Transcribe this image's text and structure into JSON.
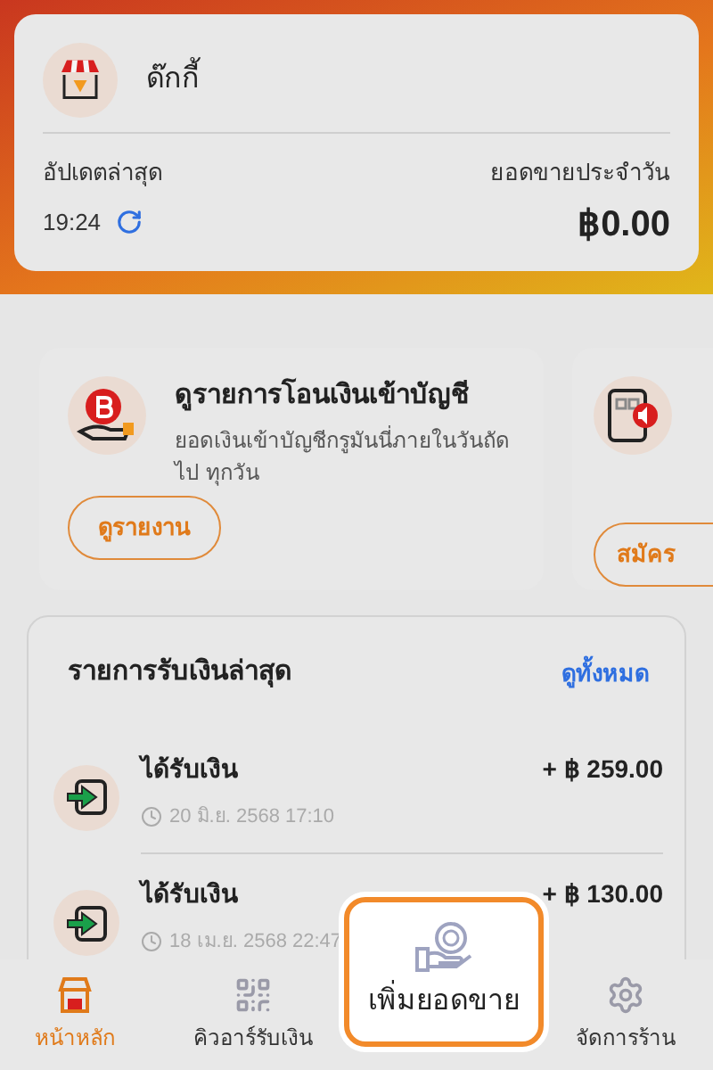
{
  "shop": {
    "name": "ด๊กกี้",
    "updated_label": "อัปเดตล่าสุด",
    "updated_time": "19:24",
    "sales_label": "ยอดขายประจำวัน",
    "sales_value": "฿0.00"
  },
  "promos": [
    {
      "title": "ดูรายการโอนเงินเข้าบัญชี",
      "description": "ยอดเงินเข้าบัญชีกรูมันนี่ภายในวันถัดไป ทุกวัน",
      "button": "ดูรายงาน"
    },
    {
      "button": "สมัคร"
    }
  ],
  "recent": {
    "title": "รายการรับเงินล่าสุด",
    "view_all": "ดูทั้งหมด",
    "items": [
      {
        "title": "ได้รับเงิน",
        "amount": "+ ฿ 259.00",
        "datetime": "20 มิ.ย. 2568 17:10"
      },
      {
        "title": "ได้รับเงิน",
        "amount": "+ ฿ 130.00",
        "datetime": "18 เม.ย. 2568 22:47"
      }
    ]
  },
  "nav": [
    {
      "kind": "home",
      "label": "หน้าหลัก",
      "selected": true
    },
    {
      "kind": "qr",
      "label": "คิวอาร์รับเงิน",
      "selected": false
    },
    {
      "kind": "sales",
      "label": "เพิ่มยอดขาย",
      "selected": false,
      "highlighted": true
    },
    {
      "kind": "settings",
      "label": "จัดการร้าน",
      "selected": false
    }
  ]
}
